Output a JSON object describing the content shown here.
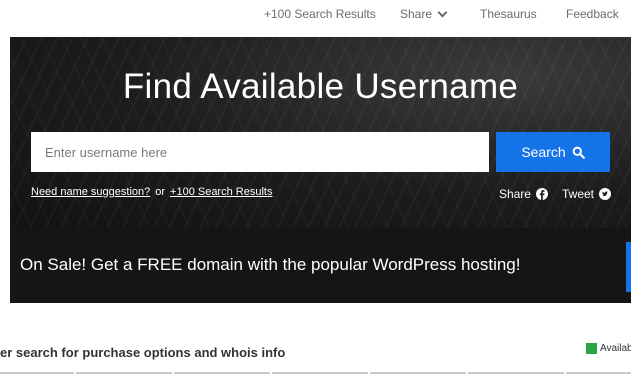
{
  "topnav": {
    "results_link": "+100 Search Results",
    "share_label": "Share",
    "thesaurus_link": "Thesaurus",
    "feedback_link": "Feedback"
  },
  "hero": {
    "title": "Find Available Username",
    "search": {
      "placeholder": "Enter username here",
      "value": "",
      "button_label": "Search"
    },
    "suggestion_link": "Need name suggestion?",
    "or_text": "or",
    "results_link": "+100 Search Results",
    "share_label": "Share",
    "tweet_label": "Tweet"
  },
  "promo": {
    "text": "On Sale! Get a FREE domain with the popular WordPress hosting!",
    "accent_color": "#1473e6"
  },
  "results": {
    "heading": "er search for purchase options and whois info",
    "legend_label": "Availab",
    "legend_color": "#2aa745"
  },
  "colors": {
    "accent": "#1473e6",
    "hero_bg": "#1c1c1c",
    "available": "#2aa745"
  }
}
